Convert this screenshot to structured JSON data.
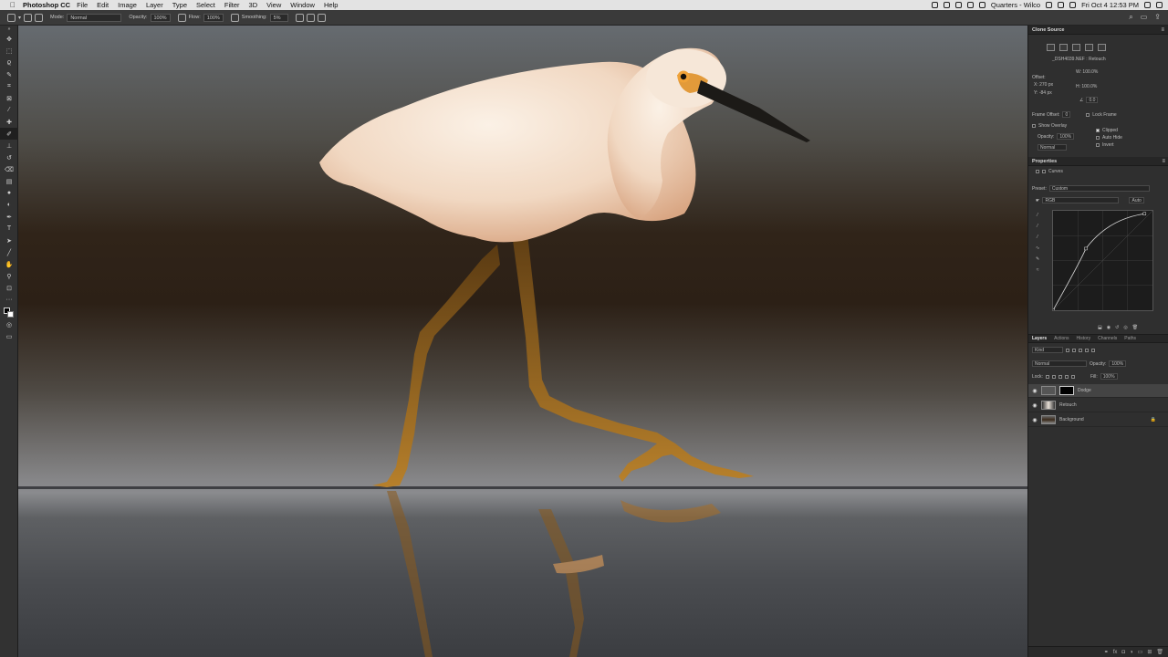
{
  "menubar": {
    "app_name": "Photoshop CC",
    "items": [
      "File",
      "Edit",
      "Image",
      "Layer",
      "Type",
      "Select",
      "Filter",
      "3D",
      "View",
      "Window",
      "Help"
    ],
    "user": "Quarters - Wilco",
    "datetime": "Fri Oct 4  12:53 PM"
  },
  "options": {
    "mode_label": "Mode:",
    "mode_value": "Normal",
    "opacity_label": "Opacity:",
    "opacity_value": "100%",
    "flow_label": "Flow:",
    "flow_value": "100%",
    "smoothing_label": "Smoothing:",
    "smoothing_value": "5%"
  },
  "clone_source": {
    "title": "Clone Source",
    "file": "_DSH4039.NEF : Retouch",
    "offset_label": "Offset:",
    "x": "X: 270 px",
    "y": "Y: -84 px",
    "w": "W: 100.0%",
    "h": "H: 100.0%",
    "angle": "0.0",
    "frame_offset_label": "Frame Offset:",
    "frame_offset_value": "0",
    "lock_frame": "Lock Frame",
    "show_overlay": "Show Overlay",
    "opacity_label": "Opacity:",
    "opacity_value": "100%",
    "blend": "Normal",
    "clipped": "Clipped",
    "auto_hide": "Auto Hide",
    "invert": "Invert"
  },
  "properties": {
    "title": "Properties",
    "adjustment": "Curves",
    "preset_label": "Preset:",
    "preset_value": "Custom",
    "channel": "RGB",
    "auto": "Auto",
    "curve_points": [
      [
        0,
        0
      ],
      [
        0.33,
        0.62
      ],
      [
        0.92,
        0.97
      ]
    ]
  },
  "layers_panel": {
    "tabs": [
      "Layers",
      "Actions",
      "History",
      "Channels",
      "Paths"
    ],
    "kind": "Kind",
    "blend": "Normal",
    "opacity_label": "Opacity:",
    "opacity_value": "100%",
    "lock_label": "Lock:",
    "fill_label": "Fill:",
    "fill_value": "100%",
    "layers": [
      {
        "name": "Dodge",
        "selected": true
      },
      {
        "name": "Retouch",
        "selected": false
      },
      {
        "name": "Background",
        "selected": false
      }
    ]
  },
  "colors": {
    "panel_bg": "#2f2f2f",
    "canvas_dark": "#2c2016",
    "egret_white": "#f4e7d9",
    "egret_warm": "#e7b08a",
    "beak": "#1c1a17",
    "legs": "#9c6a1f"
  }
}
